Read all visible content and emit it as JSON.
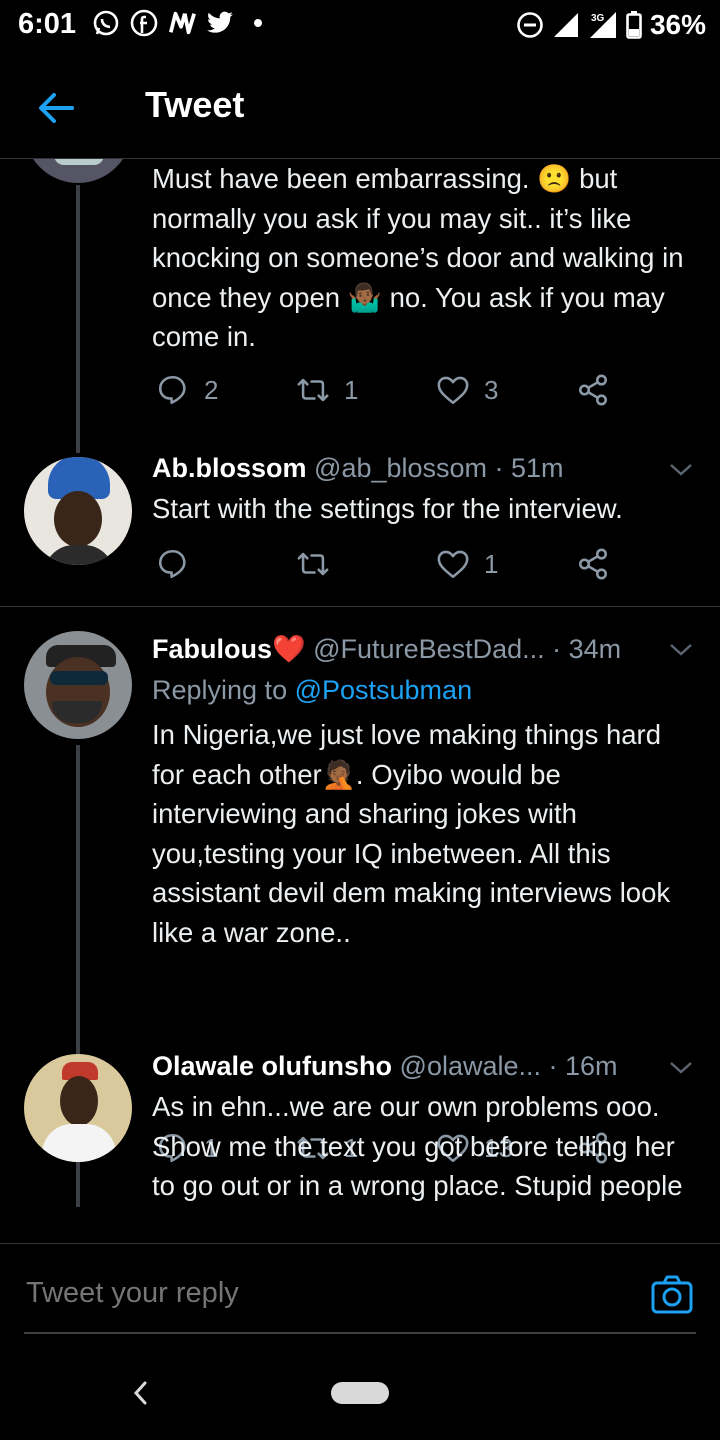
{
  "status_bar": {
    "time": "6:01",
    "network": "3G",
    "battery": "36%",
    "notification_icons": [
      "whatsapp-icon",
      "facebook-icon",
      "news-icon",
      "twitter-icon",
      "dot-icon"
    ]
  },
  "header": {
    "title": "Tweet"
  },
  "colors": {
    "accent": "#1da1f2",
    "background": "#000000",
    "muted": "#8b98a5",
    "heart_emoji": "#e0245e"
  },
  "tweets": [
    {
      "text": "Must have been embarrassing. 🙁 but normally you ask if you may sit.. it’s like knocking on someone’s door and walking in once they open 🤷🏾‍♂️ no. You ask if you may come in.",
      "replies": "2",
      "retweets": "1",
      "likes": "3"
    },
    {
      "name": "Ab.blossom",
      "handle": "@ab_blossom · 51m",
      "text": "Start with the settings for the interview.",
      "replies": "",
      "retweets": "",
      "likes": "1"
    },
    {
      "name": "Fabulous❤️",
      "handle": "@FutureBestDad... · 34m",
      "reply_prefix": "Replying to ",
      "reply_mention": "@Postsubman",
      "text": "In Nigeria,we just love making things hard for each other🤦🏾. Oyibo would be interviewing and sharing jokes with you,testing your IQ inbetween. All this assistant devil dem making interviews look like a war zone..",
      "replies": "1",
      "retweets": "1",
      "likes": "13"
    },
    {
      "name": "Olawale olufunsho",
      "handle": "@olawale...  · 16m",
      "text": "As in ehn...we are our own problems ooo. Show me the text you got before telling her to go out or in a wrong place. Stupid people"
    }
  ],
  "reply_box": {
    "placeholder": "Tweet your reply"
  }
}
